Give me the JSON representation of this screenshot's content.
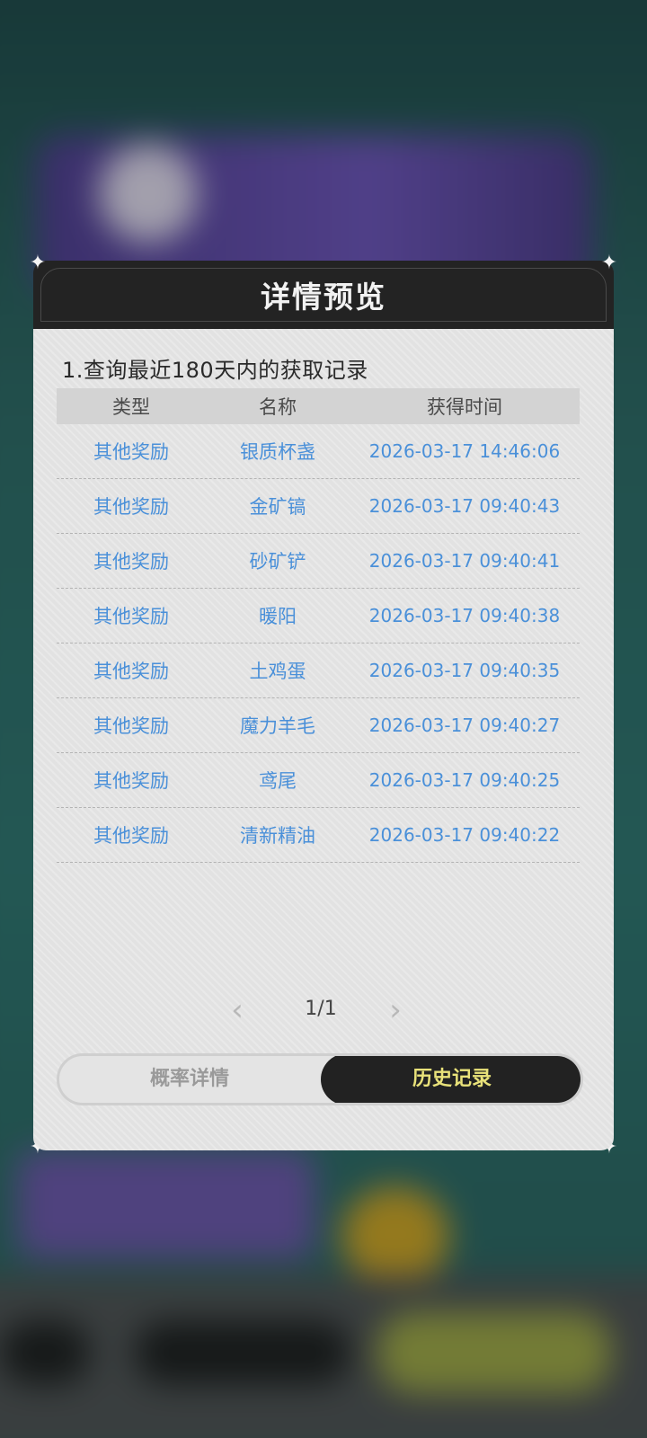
{
  "dialog": {
    "title": "详情预览",
    "subtitle": "1.查询最近180天内的获取记录",
    "table": {
      "headers": [
        "类型",
        "名称",
        "获得时间"
      ],
      "rows": [
        [
          "其他奖励",
          "银质杯盏",
          "2026-03-17 14:46:06"
        ],
        [
          "其他奖励",
          "金矿镐",
          "2026-03-17 09:40:43"
        ],
        [
          "其他奖励",
          "砂矿铲",
          "2026-03-17 09:40:41"
        ],
        [
          "其他奖励",
          "暖阳",
          "2026-03-17 09:40:38"
        ],
        [
          "其他奖励",
          "土鸡蛋",
          "2026-03-17 09:40:35"
        ],
        [
          "其他奖励",
          "魔力羊毛",
          "2026-03-17 09:40:27"
        ],
        [
          "其他奖励",
          "鸢尾",
          "2026-03-17 09:40:25"
        ],
        [
          "其他奖励",
          "清新精油",
          "2026-03-17 09:40:22"
        ]
      ]
    },
    "pager": {
      "label": "1/1",
      "prev_icon": "chevron-left-icon",
      "next_icon": "chevron-right-icon"
    },
    "tabs": [
      {
        "label": "概率详情",
        "active": false
      },
      {
        "label": "历史记录",
        "active": true
      }
    ]
  },
  "colors": {
    "link_blue": "#4a90d9",
    "active_tab_text": "#e9e27a",
    "header_bg": "#232323"
  }
}
